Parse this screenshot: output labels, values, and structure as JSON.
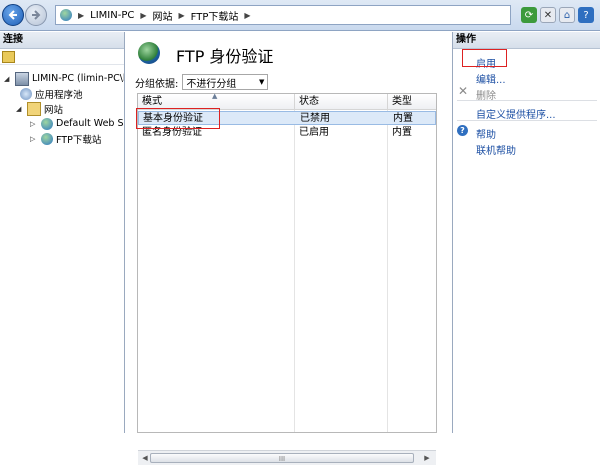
{
  "breadcrumb": [
    "LIMIN-PC",
    "网站",
    "FTP下载站"
  ],
  "left": {
    "header": "连接",
    "tree": [
      {
        "label": "LIMIN-PC (limin-PC\\l",
        "level": 0,
        "expander": "◢",
        "icon": "server-icon"
      },
      {
        "label": "应用程序池",
        "level": 1,
        "expander": "",
        "icon": "app-pool-icon"
      },
      {
        "label": "网站",
        "level": 1,
        "expander": "◢",
        "icon": "sites-folder-icon"
      },
      {
        "label": "Default Web S",
        "level": 2,
        "expander": "▷",
        "icon": "globe-icon"
      },
      {
        "label": "FTP下载站",
        "level": 2,
        "expander": "▷",
        "icon": "globe-icon"
      }
    ]
  },
  "center": {
    "title": "FTP 身份验证",
    "group_label": "分组依据:",
    "group_value": "不进行分组",
    "columns": [
      "模式",
      "状态",
      "类型"
    ],
    "rows": [
      {
        "mode": "基本身份验证",
        "status": "已禁用",
        "type": "内置",
        "selected": true
      },
      {
        "mode": "匿名身份验证",
        "status": "已启用",
        "type": "内置",
        "selected": false
      }
    ],
    "scroll_thumb": "III"
  },
  "right": {
    "header": "操作",
    "actions": [
      {
        "label": "启用",
        "enabled": true
      },
      {
        "label": "编辑...",
        "enabled": true
      },
      {
        "label": "删除",
        "enabled": false
      },
      {
        "label": "自定义提供程序...",
        "enabled": true
      }
    ],
    "help": [
      {
        "label": "帮助"
      },
      {
        "label": "联机帮助"
      }
    ]
  },
  "colors": {
    "link": "#1c4fa3",
    "highlight": "#dce9f8",
    "annotation": "#dd2222"
  }
}
